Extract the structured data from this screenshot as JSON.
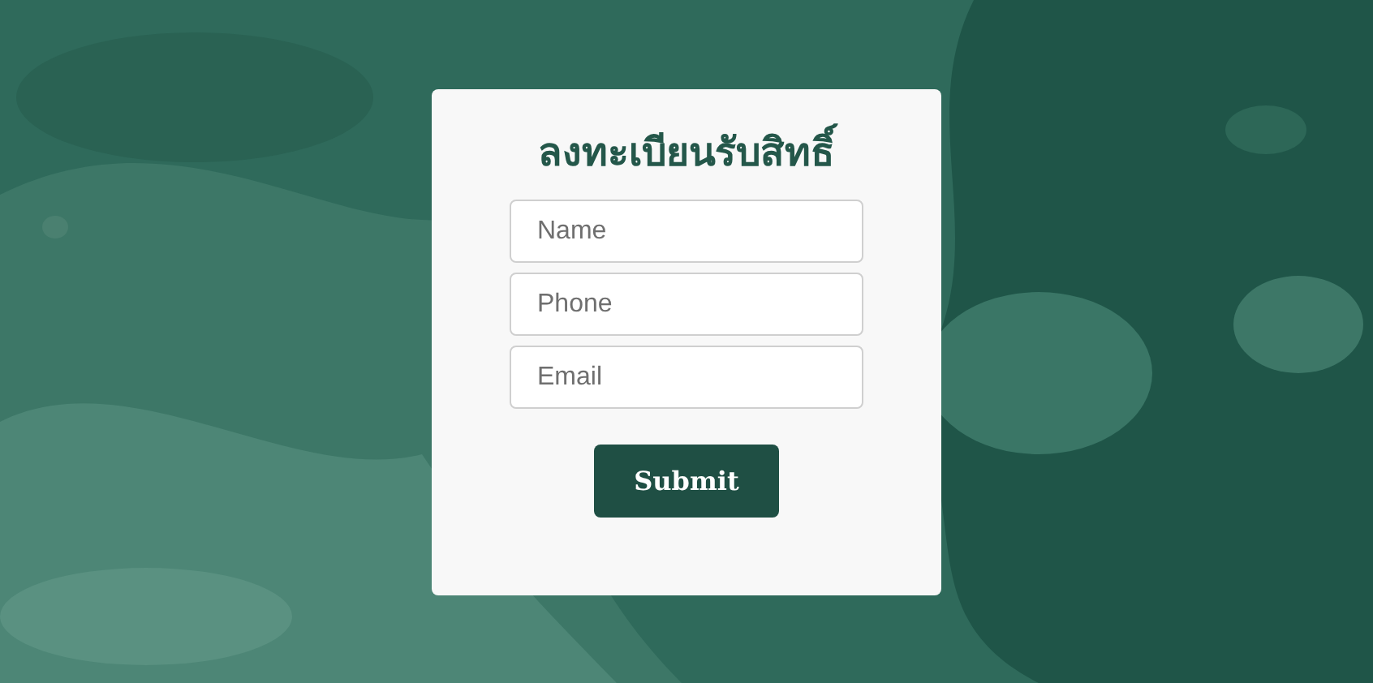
{
  "form": {
    "title": "ลงทะเบียนรับสิทธิ์",
    "fields": [
      {
        "placeholder": "Name"
      },
      {
        "placeholder": "Phone"
      },
      {
        "placeholder": "Email"
      }
    ],
    "submit": "Submit"
  }
}
